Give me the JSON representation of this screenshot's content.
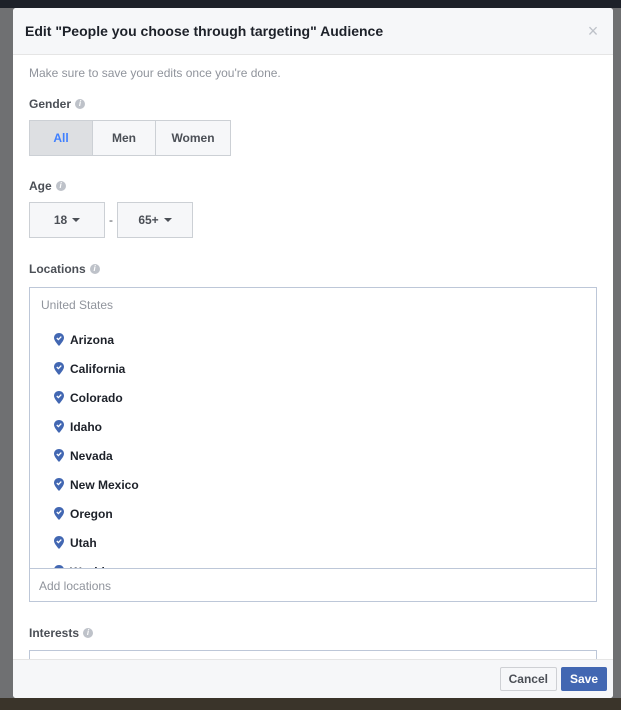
{
  "modal": {
    "title": "Edit \"People you choose through targeting\" Audience",
    "close_icon": "×",
    "hint": "Make sure to save your edits once you're done."
  },
  "gender": {
    "label": "Gender",
    "options": [
      "All",
      "Men",
      "Women"
    ],
    "selected": "All"
  },
  "age": {
    "label": "Age",
    "min": "18",
    "separator": "-",
    "max": "65+"
  },
  "locations": {
    "label": "Locations",
    "country": "United States",
    "items": [
      "Arizona",
      "California",
      "Colorado",
      "Idaho",
      "Nevada",
      "New Mexico",
      "Oregon",
      "Utah",
      "Washington"
    ],
    "placeholder": "Add locations"
  },
  "interests": {
    "label": "Interests"
  },
  "footer": {
    "cancel": "Cancel",
    "save": "Save"
  },
  "colors": {
    "accent": "#4267b2",
    "selected_text": "#4080ff",
    "pin": "#4267b2"
  }
}
